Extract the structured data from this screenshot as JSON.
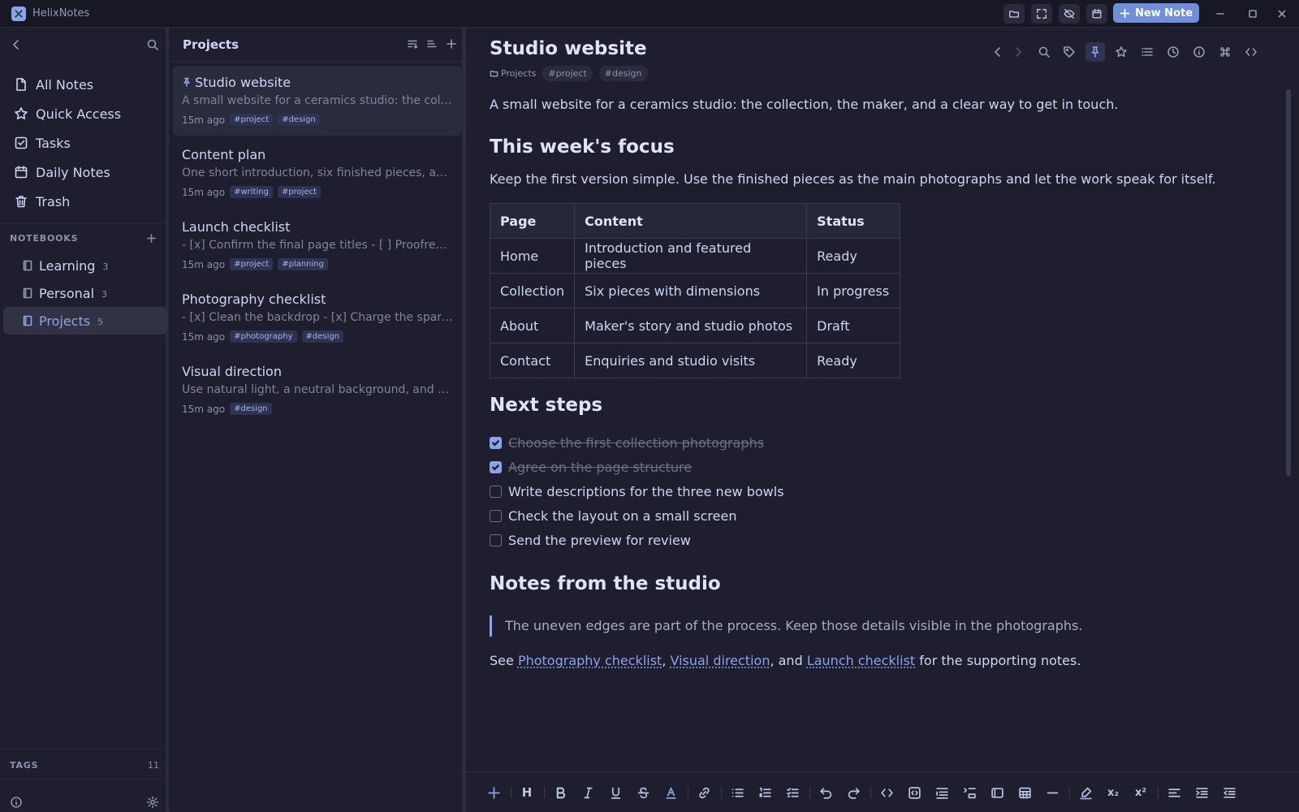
{
  "app": {
    "title": "HelixNotes",
    "new_note_label": "New Note"
  },
  "sidebar": {
    "nav": [
      {
        "label": "All Notes",
        "icon": "file-icon"
      },
      {
        "label": "Quick Access",
        "icon": "star-icon"
      },
      {
        "label": "Tasks",
        "icon": "checkbox-icon"
      },
      {
        "label": "Daily Notes",
        "icon": "calendar-icon"
      },
      {
        "label": "Trash",
        "icon": "trash-icon"
      }
    ],
    "notebooks_label": "NOTEBOOKS",
    "notebooks": [
      {
        "name": "Learning",
        "count": "3"
      },
      {
        "name": "Personal",
        "count": "3"
      },
      {
        "name": "Projects",
        "count": "5",
        "active": true
      }
    ],
    "tags_label": "TAGS",
    "tags_count": "11"
  },
  "list": {
    "title": "Projects",
    "notes": [
      {
        "title": "Studio website",
        "snippet": "A small website for a ceramics studio: the collection, the maker, and a clear way to get in touch.",
        "time": "15m ago",
        "tags": [
          "#project",
          "#design"
        ],
        "pinned": true
      },
      {
        "title": "Content plan",
        "snippet": "One short introduction, six finished pieces, and a simple contact page.",
        "time": "15m ago",
        "tags": [
          "#writing",
          "#project"
        ]
      },
      {
        "title": "Launch checklist",
        "snippet": "- [x] Confirm the final page titles - [ ] Proofread every page",
        "time": "15m ago",
        "tags": [
          "#project",
          "#planning"
        ]
      },
      {
        "title": "Photography checklist",
        "snippet": "- [x] Clean the backdrop - [x] Charge the spare batteries",
        "time": "15m ago",
        "tags": [
          "#photography",
          "#design"
        ]
      },
      {
        "title": "Visual direction",
        "snippet": "Use natural light, a neutral background, and plenty of space.",
        "time": "15m ago",
        "tags": [
          "#design"
        ]
      }
    ]
  },
  "editor": {
    "title": "Studio website",
    "folder": "Projects",
    "tags": [
      "#project",
      "#design"
    ],
    "intro": "A small website for a ceramics studio: the collection, the maker, and a clear way to get in touch.",
    "focus_heading": "This week's focus",
    "focus_text": "Keep the first version simple. Use the finished pieces as the main photographs and let the work speak for itself.",
    "table": {
      "headers": [
        "Page",
        "Content",
        "Status"
      ],
      "rows": [
        [
          "Home",
          "Introduction and featured pieces",
          "Ready"
        ],
        [
          "Collection",
          "Six pieces with dimensions",
          "In progress"
        ],
        [
          "About",
          "Maker's story and studio photos",
          "Draft"
        ],
        [
          "Contact",
          "Enquiries and studio visits",
          "Ready"
        ]
      ]
    },
    "next_heading": "Next steps",
    "tasks": [
      {
        "label": "Choose the first collection photographs",
        "done": true
      },
      {
        "label": "Agree on the page structure",
        "done": true
      },
      {
        "label": "Write descriptions for the three new bowls",
        "done": false
      },
      {
        "label": "Check the layout on a small screen",
        "done": false
      },
      {
        "label": "Send the preview for review",
        "done": false
      }
    ],
    "notes_heading": "Notes from the studio",
    "quote": "The uneven edges are part of the process. Keep those details visible in the photographs.",
    "see": {
      "prefix": "See ",
      "link1": "Photography checklist",
      "sep1": ", ",
      "link2": "Visual direction",
      "sep2": ", and ",
      "link3": "Launch checklist",
      "suffix": " for the supporting notes."
    }
  },
  "toolbar": {
    "heading_label": "H",
    "subscript_label": "x₂",
    "superscript_label": "x²"
  },
  "colors": {
    "accent": "#89a4e8",
    "background": "#1e1e2e",
    "panel": "#181825",
    "primary_button": "#6f8fd8"
  }
}
